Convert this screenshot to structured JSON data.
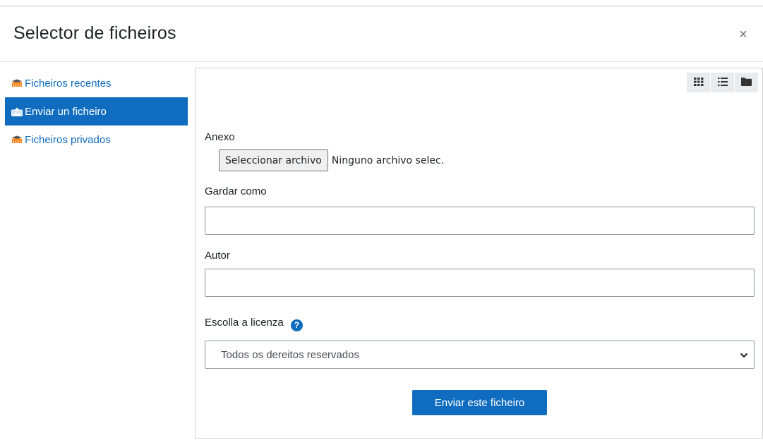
{
  "modal": {
    "title": "Selector de ficheiros",
    "close_symbol": "×"
  },
  "sidebar": {
    "items": [
      {
        "label": "Ficheiros recentes",
        "icon": "moodle-icon",
        "active": false
      },
      {
        "label": "Enviar un ficheiro",
        "icon": "upload-icon",
        "active": true
      },
      {
        "label": "Ficheiros privados",
        "icon": "moodle-icon",
        "active": false
      }
    ]
  },
  "toolbar": {
    "views": [
      "grid-view-icon",
      "list-view-icon",
      "folder-view-icon"
    ]
  },
  "form": {
    "attachment_label": "Anexo",
    "choose_file_label": "Seleccionar archivo",
    "no_file_text": "Ninguno archivo selec.",
    "save_as_label": "Gardar como",
    "save_as_value": "",
    "author_label": "Autor",
    "author_value": "",
    "license_label": "Escolla a licenza",
    "license_selected": "Todos os dereitos reservados",
    "submit_label": "Enviar este ficheiro"
  },
  "colors": {
    "primary": "#0f6cbf",
    "moodle_orange": "#f98012",
    "toolbar_bg": "#e9ecef"
  }
}
